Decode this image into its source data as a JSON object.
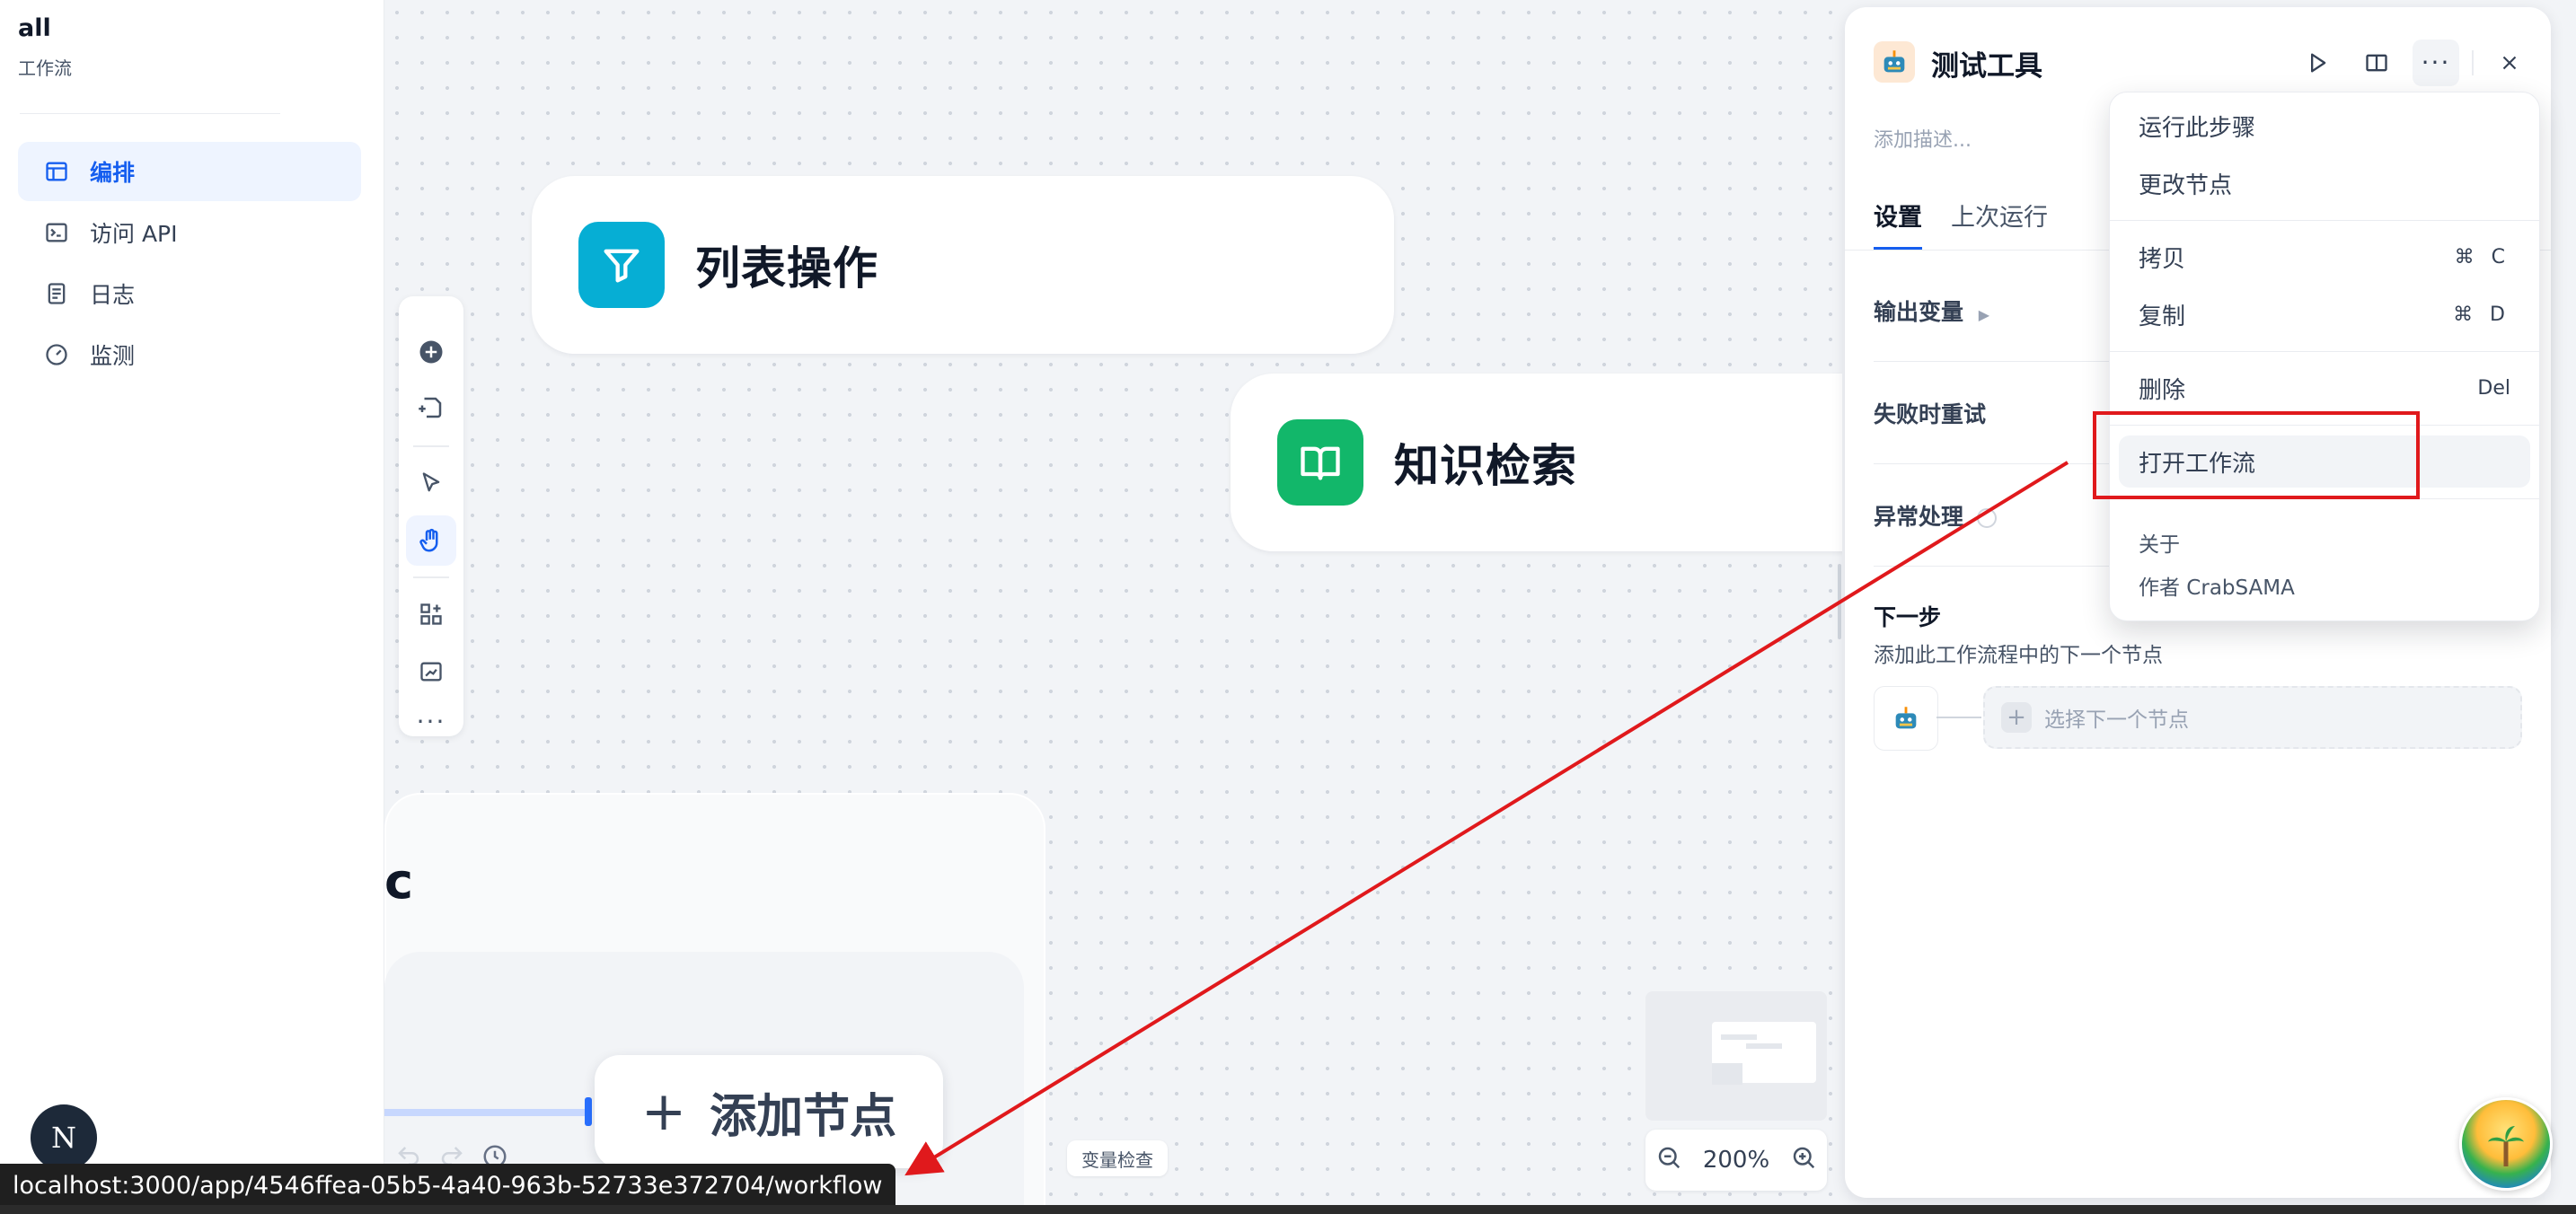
{
  "sidebar": {
    "app_name": "all",
    "app_type": "工作流",
    "items": [
      {
        "label": "编排",
        "icon": "layout-icon",
        "active": true
      },
      {
        "label": "访问 API",
        "icon": "terminal-icon",
        "active": false
      },
      {
        "label": "日志",
        "icon": "log-icon",
        "active": false
      },
      {
        "label": "监测",
        "icon": "gauge-icon",
        "active": false
      }
    ],
    "avatar_letter": "N"
  },
  "canvas": {
    "nodes": [
      {
        "title": "列表操作",
        "icon": "filter-icon",
        "color": "#06aed4"
      },
      {
        "title": "知识检索",
        "icon": "book-icon",
        "color": "#12b76a"
      }
    ],
    "partial_text": "c",
    "add_node_label": "添加节点",
    "add_node_plus": "+",
    "variable_inspect": "变量检查",
    "zoom_level": "200%"
  },
  "panel": {
    "title": "测试工具",
    "description_placeholder": "添加描述...",
    "tabs": [
      {
        "label": "设置",
        "active": true
      },
      {
        "label": "上次运行",
        "active": false
      }
    ],
    "rows": {
      "output_vars": "输出变量",
      "retry": "失败时重试",
      "error_handling": "异常处理"
    },
    "next_step": {
      "title": "下一步",
      "description": "添加此工作流程中的下一个节点",
      "select_label": "选择下一个节点"
    }
  },
  "menu": {
    "items": [
      {
        "label": "运行此步骤",
        "shortcut": ""
      },
      {
        "label": "更改节点",
        "shortcut": ""
      },
      {
        "label": "拷贝",
        "shortcut": "⌘ C"
      },
      {
        "label": "复制",
        "shortcut": "⌘ D"
      },
      {
        "label": "删除",
        "shortcut": "Del"
      },
      {
        "label": "打开工作流",
        "shortcut": ""
      }
    ],
    "about": "关于",
    "author": "作者 CrabSAMA"
  },
  "status_url": "localhost:3000/app/4546ffea-05b5-4a40-963b-52733e372704/workflow",
  "colors": {
    "accent": "#155eef",
    "annotation": "#e0191c"
  }
}
